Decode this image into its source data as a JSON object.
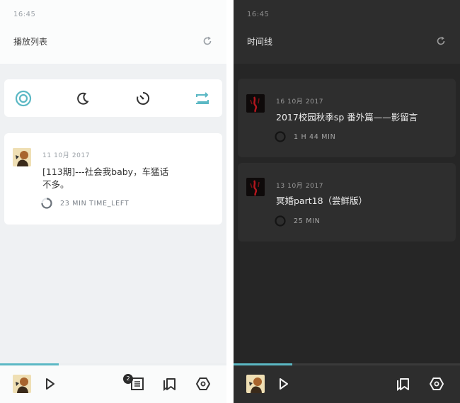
{
  "light_screen": {
    "status_time": "16:45",
    "title": "播放列表",
    "mode_icons": [
      "target-icon",
      "moon-icon",
      "timer-icon",
      "repeat-icon"
    ],
    "playlist": [
      {
        "date": "11 10月 2017",
        "title_line1": "[113期]---社会我baby，车猛话",
        "title_line2": "不多。",
        "duration": "23 MIN TIME_LEFT",
        "remaining_fraction": 0.75
      }
    ],
    "player": {
      "progress": 0.26
    },
    "queue_badge": "2"
  },
  "dark_screen": {
    "status_time": "16:45",
    "title": "时间线",
    "timeline": [
      {
        "date": "16 10月 2017",
        "title": "2017校园秋季sp 番外篇——影留言",
        "duration": "1 H 44 MIN"
      },
      {
        "date": "13 10月 2017",
        "title": "冥婚part18（尝鲜版）",
        "duration": "25 MIN"
      }
    ],
    "player": {
      "progress": 0.26
    }
  },
  "colors": {
    "accent": "#5bb8c4",
    "light_bg": "#eff1f3",
    "dark_bg": "#262626"
  }
}
